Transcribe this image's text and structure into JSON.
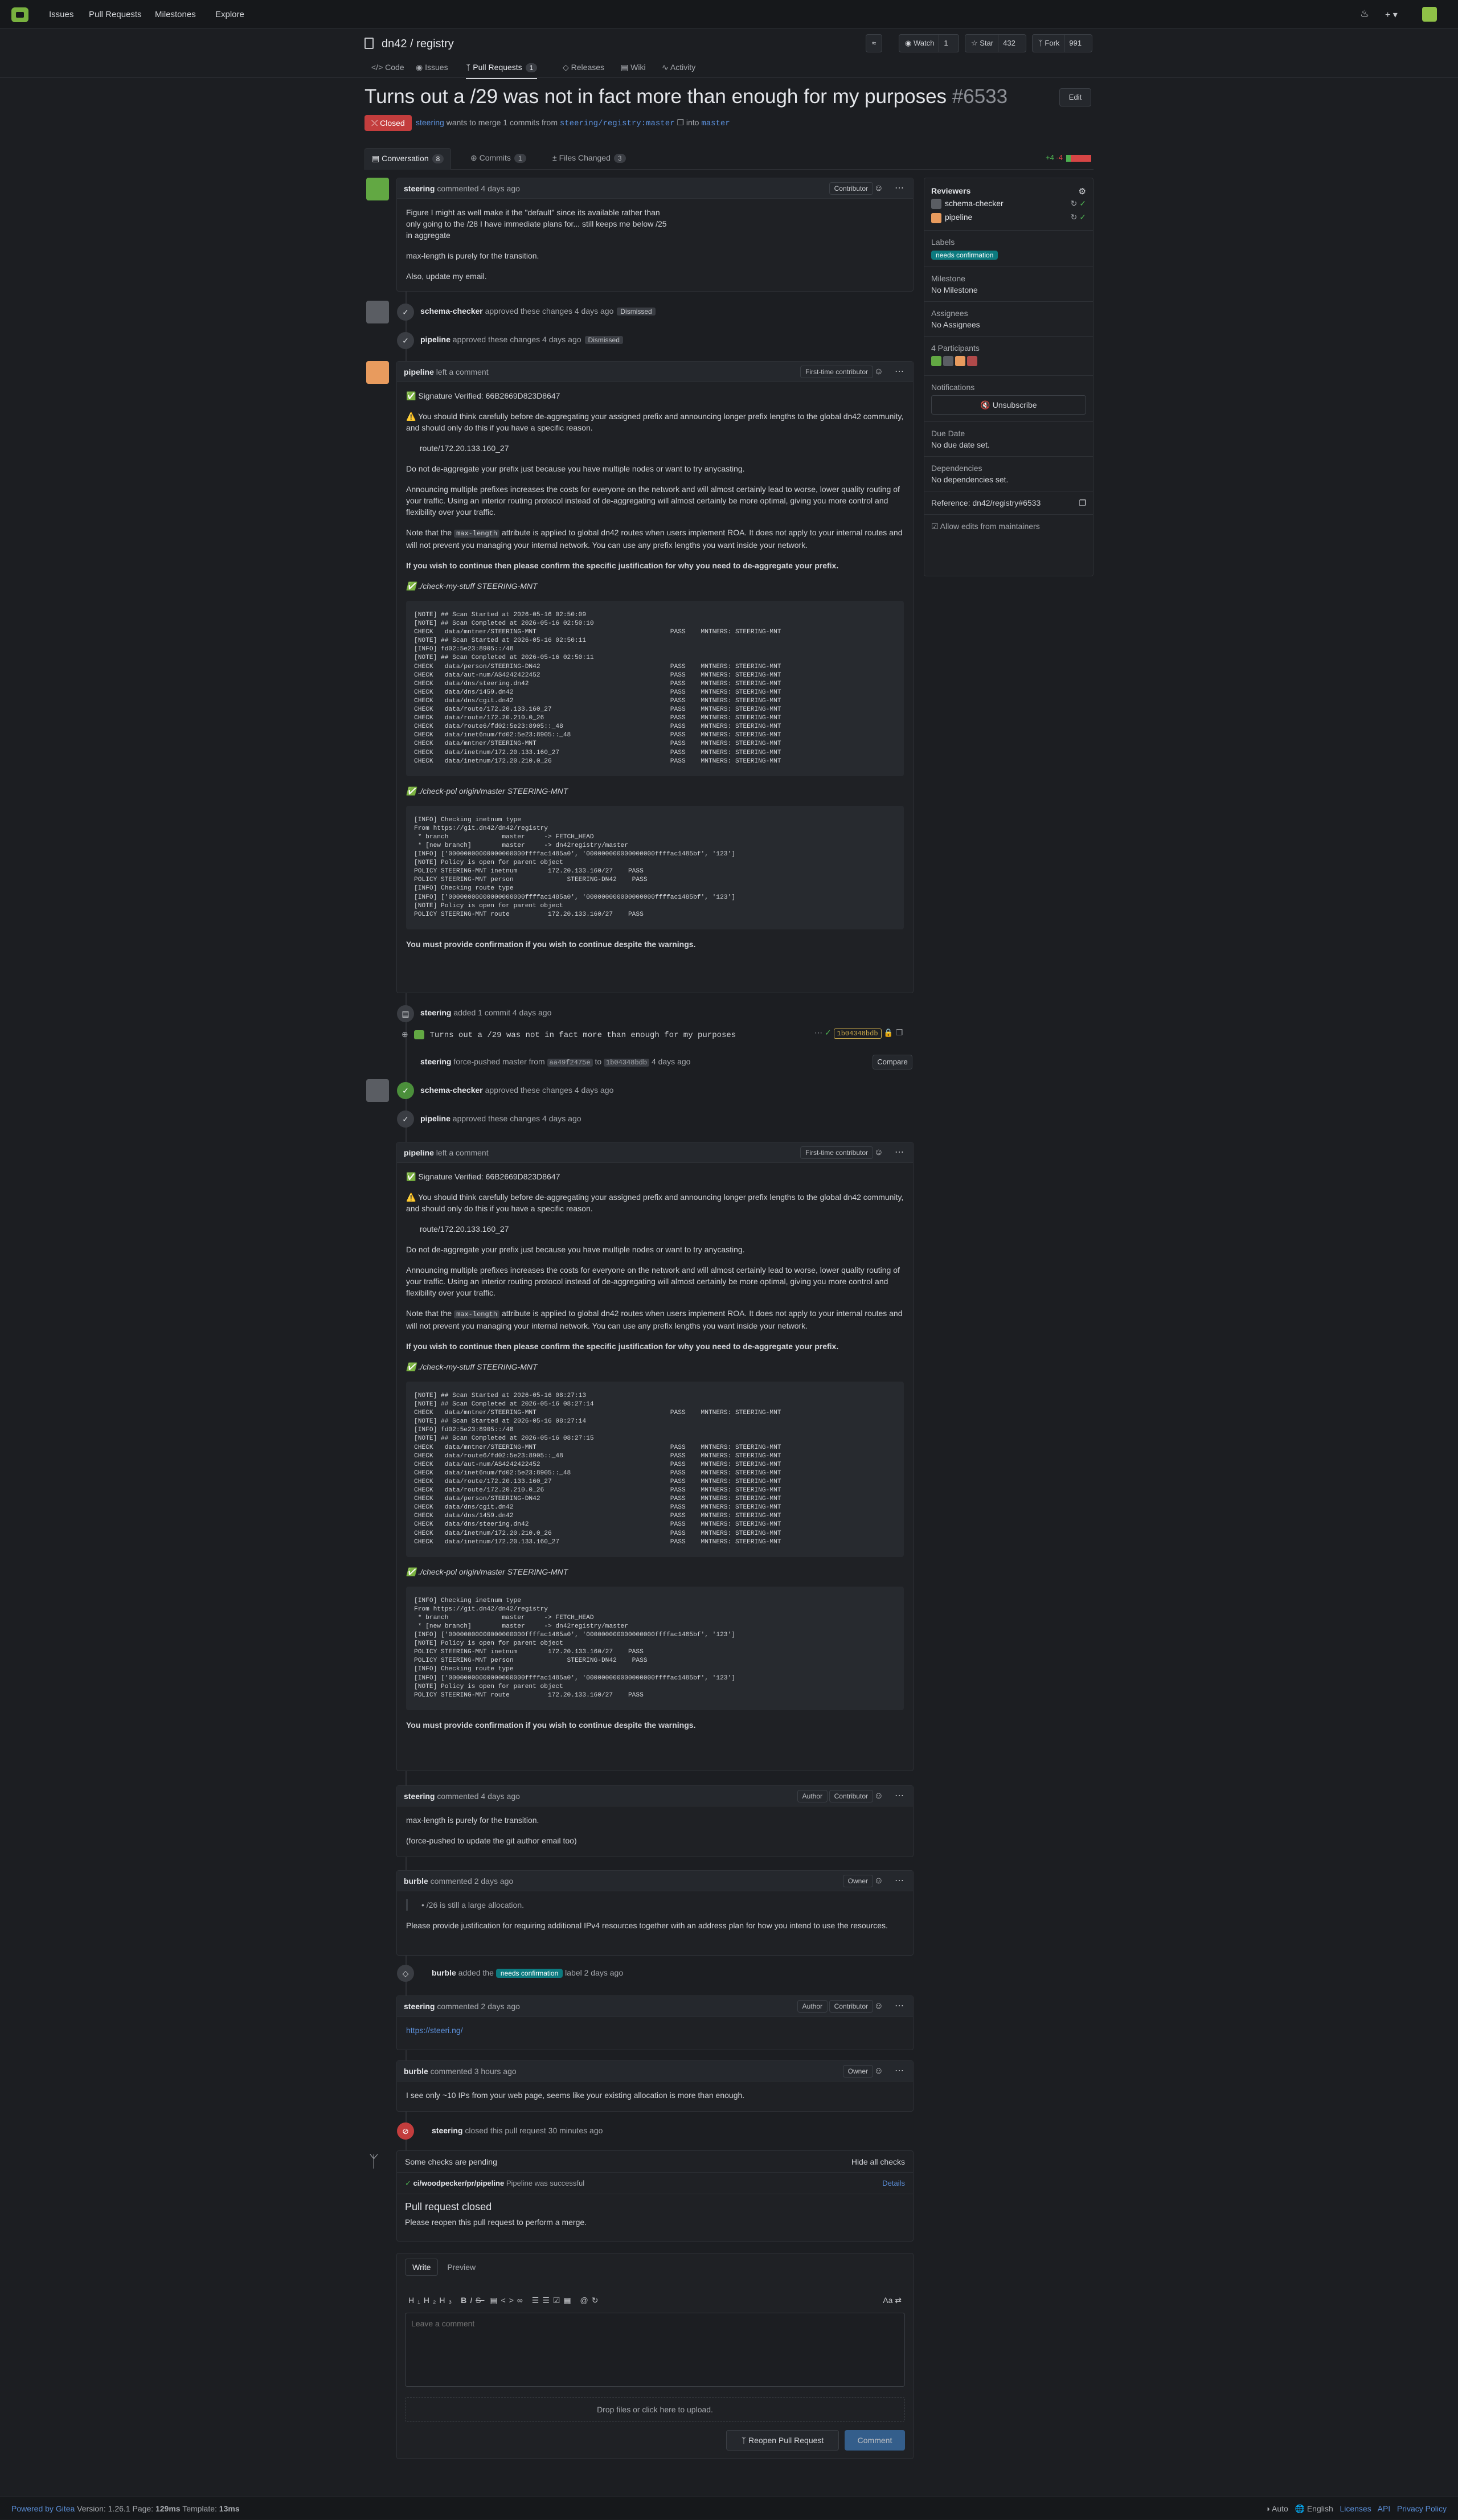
{
  "nav": {
    "issues": "Issues",
    "pulls": "Pull Requests",
    "milestones": "Milestones",
    "explore": "Explore",
    "bell": "bell-icon",
    "plus": "+ ▾"
  },
  "repo": {
    "owner": "dn42",
    "name": "registry",
    "title": "dn42 / registry",
    "rss": "rss-icon",
    "watch": "Watch",
    "watch_count": "1",
    "star": "Star",
    "star_count": "432",
    "fork": "Fork",
    "fork_count": "991",
    "tabs": [
      {
        "label": "Code"
      },
      {
        "label": "Issues"
      },
      {
        "label": "Pull Requests",
        "count": "1"
      },
      {
        "label": "Releases"
      },
      {
        "label": "Wiki"
      },
      {
        "label": "Activity"
      }
    ]
  },
  "pr": {
    "title": "Turns out a /29 was not in fact more than enough for my purposes",
    "number": "#6533",
    "edit": "Edit",
    "status": "Closed",
    "author": "steering",
    "merge_text": "wants to merge 1 commits from",
    "source": "steering/registry:master",
    "into": "into",
    "target": "master",
    "tabs": [
      {
        "label": "Conversation",
        "count": "8"
      },
      {
        "label": "Commits",
        "count": "1"
      },
      {
        "label": "Files Changed",
        "count": "3"
      }
    ],
    "additions": "+4",
    "deletions": "-4"
  },
  "comment1": {
    "author": "steering",
    "action": "commented 4 days ago",
    "role": "Contributor",
    "p1": "Figure I might as well make it the \"default\" since its available rather than only going to the /28 I have immediate plans for... still keeps me below /25 in aggregate",
    "p2": "max-length is purely for the transition.",
    "p3": "Also, update my email."
  },
  "ev_schema1": {
    "actor": "schema-checker",
    "text": "approved these changes 4 days ago",
    "tag": "Dismissed"
  },
  "ev_pipe1": {
    "actor": "pipeline",
    "text": "approved these changes 4 days ago",
    "tag": "Dismissed"
  },
  "bot": {
    "author": "pipeline",
    "action": "left a comment",
    "role": "First-time contributor",
    "sig1": "✅ Signature Verified: 66B2669D823D8647",
    "warn": "⚠️ You should think carefully before de-aggregating your assigned prefix and announcing longer prefix lengths to the global dn42 community, and should only do this if you have a specific reason.",
    "route": "route/172.20.133.160_27",
    "p_noagg": "Do not de-aggregate your prefix just because you have multiple nodes or want to try anycasting.",
    "p_announce": "Announcing multiple prefixes increases the costs for everyone on the network and will almost certainly lead to worse, lower quality routing of your traffic. Using an interior routing protocol instead of de-aggregating will almost certainly be more optimal, giving you more control and flexibility over your traffic.",
    "p_note1": "Note that the",
    "maxlen": "max-length",
    "p_note2": "attribute is applied to global dn42 routes when users implement ROA. It does not apply to your internal routes and will not prevent you managing your internal network. You can use any prefix lengths you want inside your network.",
    "p_confirm": "If you wish to continue then please confirm the specific justification for why you need to de-aggregate your prefix.",
    "check1": "✅ ./check-my-stuff STEERING-MNT",
    "check2": "✅ ./check-pol origin/master STEERING-MNT",
    "p_must": "You must provide confirmation if you wish to continue despite the warnings.",
    "log1": "[NOTE] ## Scan Started at 2026-05-16 02:50:09\n[NOTE] ## Scan Completed at 2026-05-16 02:50:10\nCHECK   data/mntner/STEERING-MNT                                   PASS    MNTNERS: STEERING-MNT\n[NOTE] ## Scan Started at 2026-05-16 02:50:11\n[INFO] fd02:5e23:8905::/48\n[NOTE] ## Scan Completed at 2026-05-16 02:50:11\nCHECK   data/person/STEERING-DN42                                  PASS    MNTNERS: STEERING-MNT\nCHECK   data/aut-num/AS4242422452                                  PASS    MNTNERS: STEERING-MNT\nCHECK   data/dns/steering.dn42                                     PASS    MNTNERS: STEERING-MNT\nCHECK   data/dns/1459.dn42                                         PASS    MNTNERS: STEERING-MNT\nCHECK   data/dns/cgit.dn42                                         PASS    MNTNERS: STEERING-MNT\nCHECK   data/route/172.20.133.160_27                               PASS    MNTNERS: STEERING-MNT\nCHECK   data/route/172.20.210.0_26                                 PASS    MNTNERS: STEERING-MNT\nCHECK   data/route6/fd02:5e23:8905::_48                            PASS    MNTNERS: STEERING-MNT\nCHECK   data/inet6num/fd02:5e23:8905::_48                          PASS    MNTNERS: STEERING-MNT\nCHECK   data/mntner/STEERING-MNT                                   PASS    MNTNERS: STEERING-MNT\nCHECK   data/inetnum/172.20.133.160_27                             PASS    MNTNERS: STEERING-MNT\nCHECK   data/inetnum/172.20.210.0_26                               PASS    MNTNERS: STEERING-MNT",
    "log2": "[INFO] Checking inetnum type\nFrom https://git.dn42/dn42/registry\n * branch              master     -> FETCH_HEAD\n * [new branch]        master     -> dn42registry/master\n[INFO] ['00000000000000000000ffffac1485a0', '000000000000000000ffffac1485bf', '123']\n[NOTE] Policy is open for parent object\nPOLICY STEERING-MNT inetnum        172.20.133.160/27    PASS\nPOLICY STEERING-MNT person              STEERING-DN42    PASS\n[INFO] Checking route type\n[INFO] ['00000000000000000000ffffac1485a0', '000000000000000000ffffac1485bf', '123']\n[NOTE] Policy is open for parent object\nPOLICY STEERING-MNT route          172.20.133.160/27    PASS",
    "log3": "[NOTE] ## Scan Started at 2026-05-16 08:27:13\n[NOTE] ## Scan Completed at 2026-05-16 08:27:14\nCHECK   data/mntner/STEERING-MNT                                   PASS    MNTNERS: STEERING-MNT\n[NOTE] ## Scan Started at 2026-05-16 08:27:14\n[INFO] fd02:5e23:8905::/48\n[NOTE] ## Scan Completed at 2026-05-16 08:27:15\nCHECK   data/mntner/STEERING-MNT                                   PASS    MNTNERS: STEERING-MNT\nCHECK   data/route6/fd02:5e23:8905::_48                            PASS    MNTNERS: STEERING-MNT\nCHECK   data/aut-num/AS4242422452                                  PASS    MNTNERS: STEERING-MNT\nCHECK   data/inet6num/fd02:5e23:8905::_48                          PASS    MNTNERS: STEERING-MNT\nCHECK   data/route/172.20.133.160_27                               PASS    MNTNERS: STEERING-MNT\nCHECK   data/route/172.20.210.0_26                                 PASS    MNTNERS: STEERING-MNT\nCHECK   data/person/STEERING-DN42                                  PASS    MNTNERS: STEERING-MNT\nCHECK   data/dns/cgit.dn42                                         PASS    MNTNERS: STEERING-MNT\nCHECK   data/dns/1459.dn42                                         PASS    MNTNERS: STEERING-MNT\nCHECK   data/dns/steering.dn42                                     PASS    MNTNERS: STEERING-MNT\nCHECK   data/inetnum/172.20.210.0_26                               PASS    MNTNERS: STEERING-MNT\nCHECK   data/inetnum/172.20.133.160_27                             PASS    MNTNERS: STEERING-MNT"
  },
  "ev_commit": {
    "actor": "steering",
    "text": "added 1 commit 4 days ago",
    "msg": "Turns out a /29 was not in fact more than enough for my purposes",
    "sha": "1b04348bdb"
  },
  "ev_push": {
    "actor": "steering",
    "text1": "force-pushed master from",
    "from": "aa49f2475e",
    "to_word": "to",
    "to": "1b04348bdb",
    "text2": "4 days ago",
    "compare": "Compare"
  },
  "ev_schema2": {
    "actor": "schema-checker",
    "text": "approved these changes 4 days ago"
  },
  "ev_pipe2": {
    "actor": "pipeline",
    "text": "approved these changes 4 days ago"
  },
  "comment2": {
    "author": "steering",
    "action": "commented 4 days ago",
    "role1": "Author",
    "role2": "Contributor",
    "p1": "max-length is purely for the transition.",
    "p2": "(force-pushed to update the git author email too)"
  },
  "comment3": {
    "author": "burble",
    "action": "commented 2 days ago",
    "role": "Owner",
    "quote": "/26 is still a large allocation.",
    "p1": "Please provide justification for requiring additional IPv4 resources together with an address plan for how you intend to use the resources."
  },
  "ev_label": {
    "actor": "burble",
    "text1": "added the",
    "label": "needs confirmation",
    "text2": "label 2 days ago"
  },
  "comment4": {
    "author": "steering",
    "action": "commented 2 days ago",
    "role1": "Author",
    "role2": "Contributor",
    "link": "https://steeri.ng/"
  },
  "comment5": {
    "author": "burble",
    "action": "commented 3 hours ago",
    "role": "Owner",
    "p1": "I see only ~10 IPs from your web page, seems like your existing allocation is more than enough."
  },
  "ev_close": {
    "actor": "steering",
    "text": "closed this pull request 30 minutes ago"
  },
  "checks": {
    "title": "Some checks are pending",
    "hide": "Hide all checks",
    "name": "ci/woodpecker/pr/pipeline",
    "status": "Pipeline was successful",
    "details": "Details",
    "closed_title": "Pull request closed",
    "closed_text": "Please reopen this pull request to perform a merge."
  },
  "editor": {
    "write": "Write",
    "preview": "Preview",
    "placeholder": "Leave a comment",
    "drop": "Drop files or click here to upload.",
    "reopen": "Reopen Pull Request",
    "comment": "Comment"
  },
  "sidebar": {
    "reviewers": "Reviewers",
    "reviewer1": "schema-checker",
    "reviewer2": "pipeline",
    "labels": "Labels",
    "label": "needs confirmation",
    "milestone": "Milestone",
    "no_milestone": "No Milestone",
    "assignees": "Assignees",
    "no_assignees": "No Assignees",
    "participants": "4 Participants",
    "notifications": "Notifications",
    "unsubscribe": "Unsubscribe",
    "due": "Due Date",
    "no_due": "No due date set.",
    "deps": "Dependencies",
    "no_deps": "No dependencies set.",
    "reference": "Reference: dn42/registry#6533",
    "allow": "Allow edits from maintainers"
  },
  "footer": {
    "powered": "Powered by Gitea",
    "version": "Version: 1.26.1",
    "page": "Page:",
    "page_time": "129ms",
    "template": "Template:",
    "tmpl_time": "13ms",
    "auto": "Auto",
    "english": "English",
    "licenses": "Licenses",
    "api": "API",
    "privacy": "Privacy Policy"
  },
  "colors": {
    "accent": "#5b8fd9",
    "closed": "#c33d3d",
    "approved": "#4b8f3b",
    "label": "#0c7a7f"
  }
}
